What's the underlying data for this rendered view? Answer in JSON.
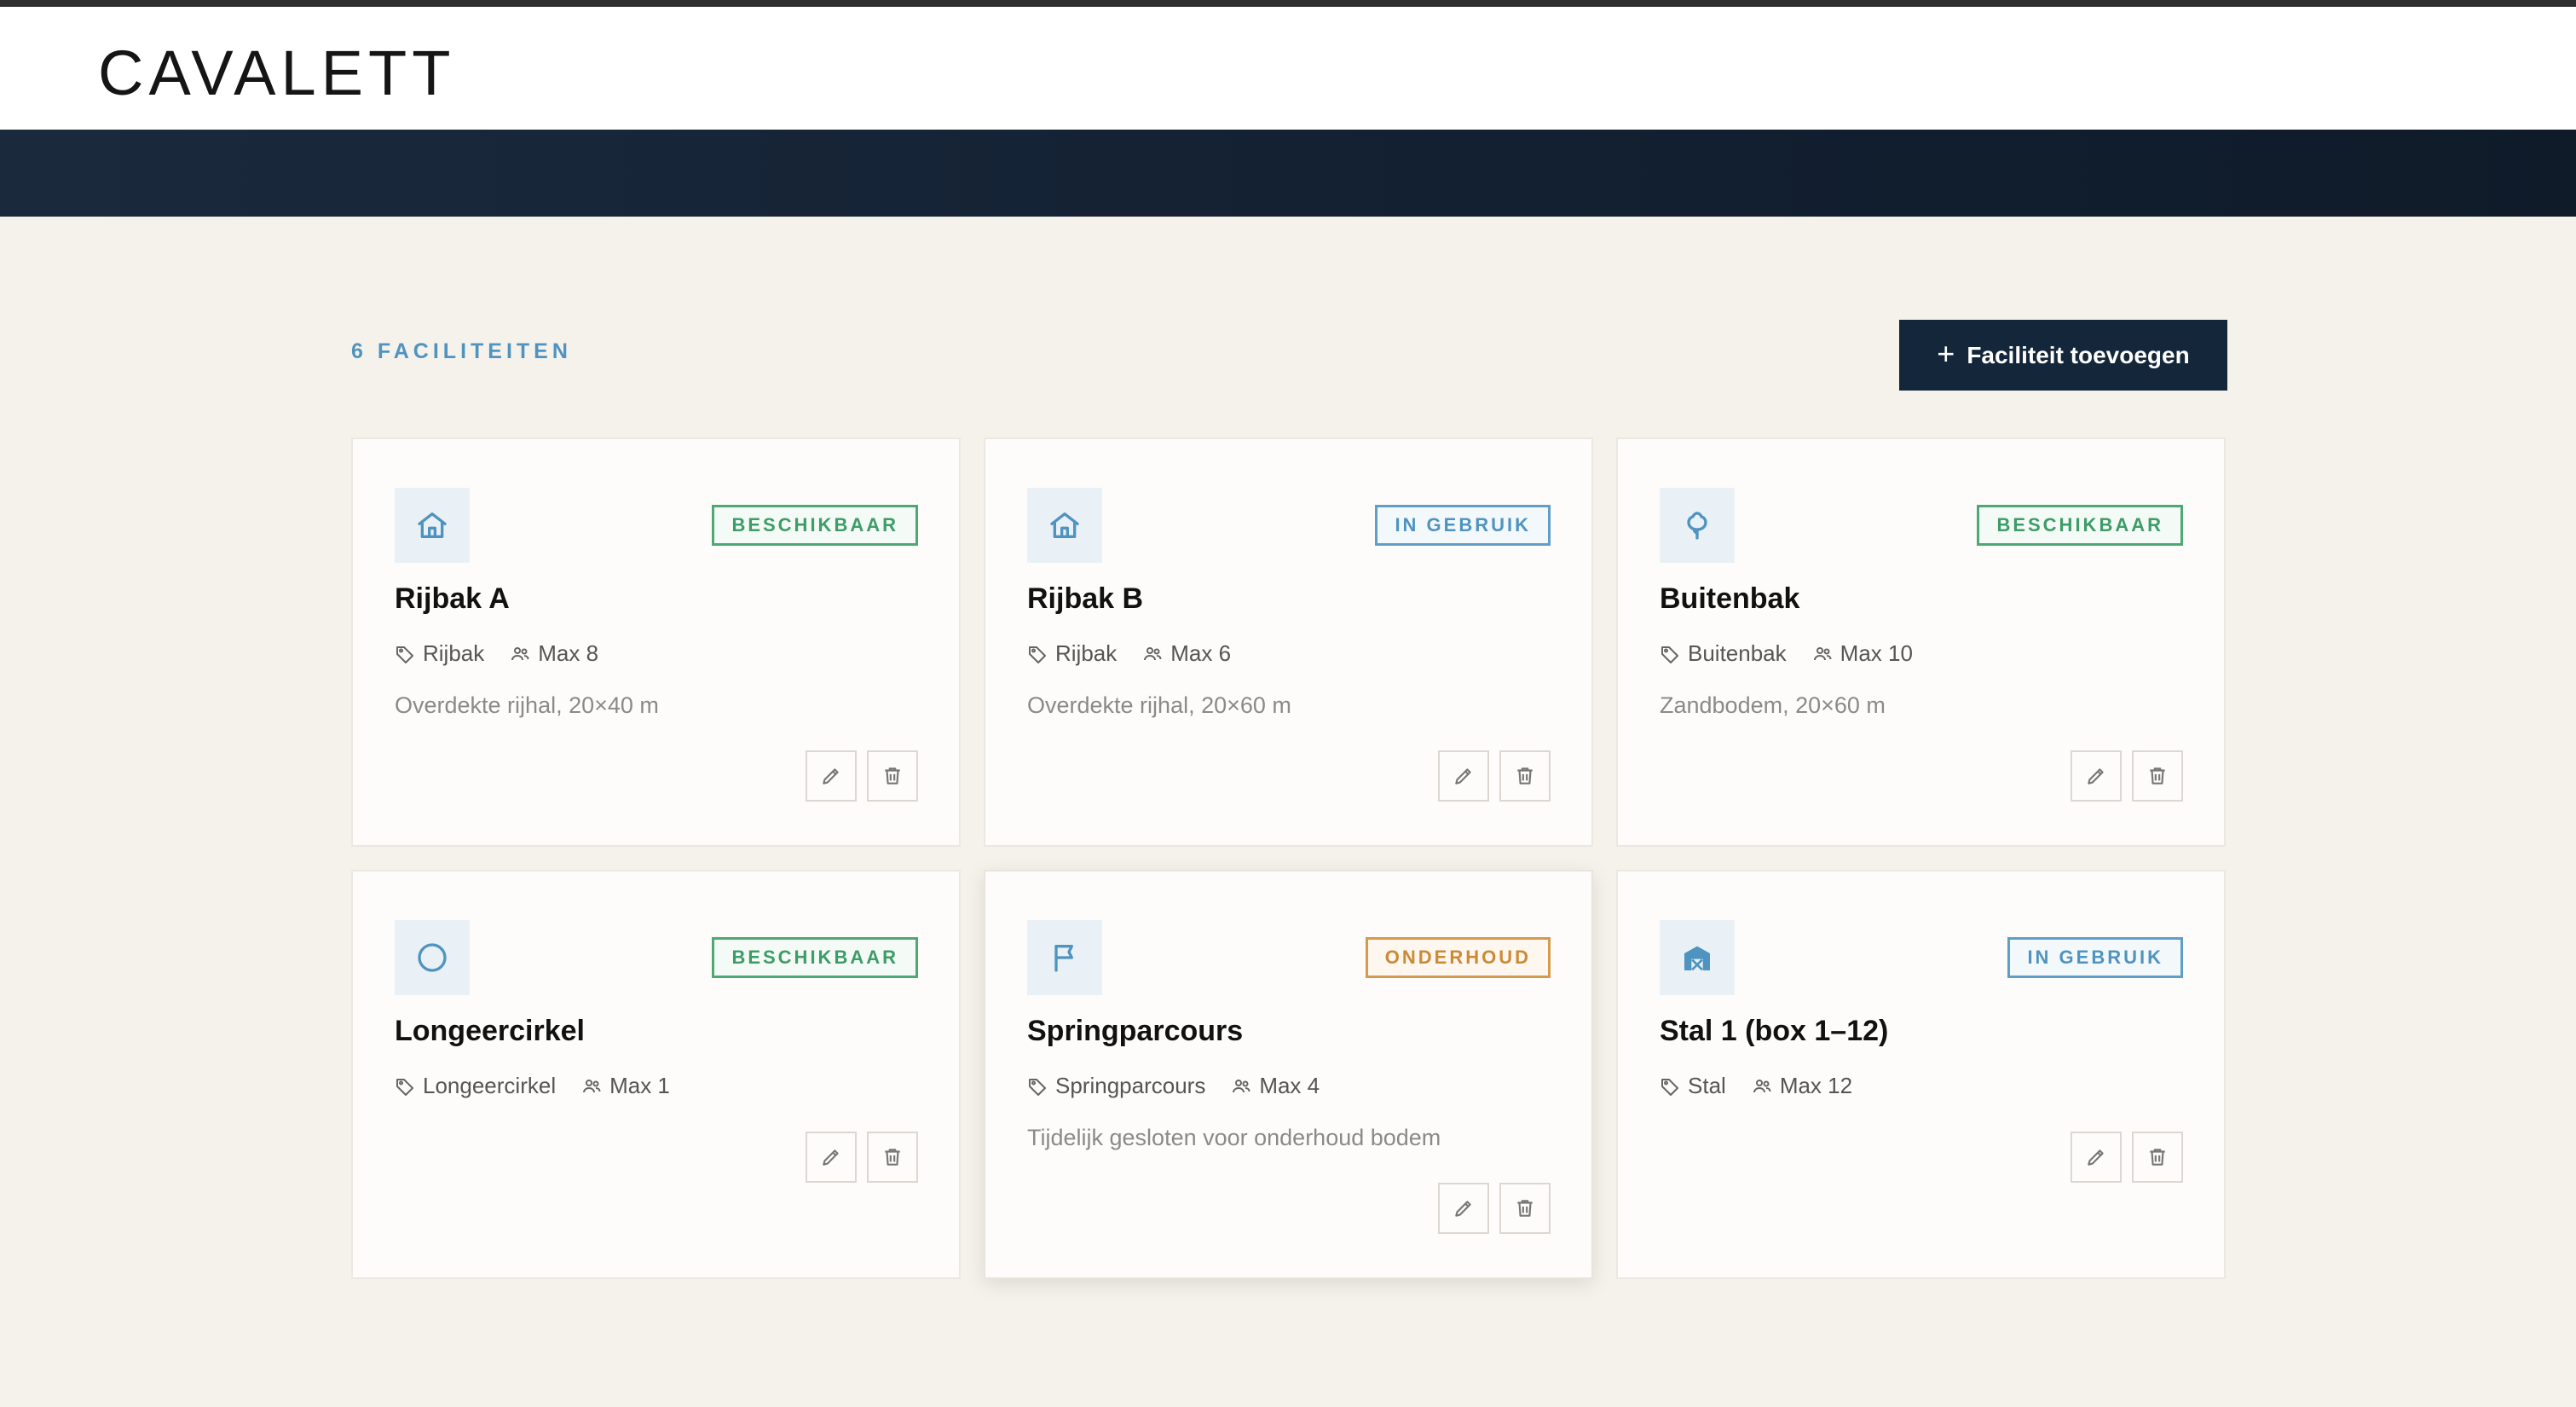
{
  "app": {
    "logo": "CAVALETT"
  },
  "toolbar": {
    "count_label": "6 FACILITEITEN",
    "add_label": "Faciliteit toevoegen",
    "add_icon": "plus-icon"
  },
  "colors": {
    "accent": "#4f94c0",
    "banner": "#132133",
    "available": "#3d9c67",
    "in_use": "#4f94c0",
    "maintenance": "#cc8a35",
    "page_bg": "#f5f2ec"
  },
  "facilities": [
    {
      "title": "Rijbak A",
      "icon": "house-icon",
      "status": "BESCHIKBAAR",
      "status_kind": "available",
      "type": "Rijbak",
      "capacity": "Max 8",
      "description": "Overdekte rijhal, 20×40 m"
    },
    {
      "title": "Rijbak B",
      "icon": "house-icon",
      "status": "IN GEBRUIK",
      "status_kind": "inuse",
      "type": "Rijbak",
      "capacity": "Max 6",
      "description": "Overdekte rijhal, 20×60 m"
    },
    {
      "title": "Buitenbak",
      "icon": "tree-icon",
      "status": "BESCHIKBAAR",
      "status_kind": "available",
      "type": "Buitenbak",
      "capacity": "Max 10",
      "description": "Zandbodem, 20×60 m"
    },
    {
      "title": "Longeercirkel",
      "icon": "circle-icon",
      "status": "BESCHIKBAAR",
      "status_kind": "available",
      "type": "Longeercirkel",
      "capacity": "Max 1",
      "description": ""
    },
    {
      "title": "Springparcours",
      "icon": "flag-icon",
      "status": "ONDERHOUD",
      "status_kind": "maint",
      "type": "Springparcours",
      "capacity": "Max 4",
      "description": "Tijdelijk gesloten voor onderhoud bodem"
    },
    {
      "title": "Stal 1 (box 1–12)",
      "icon": "barn-icon",
      "status": "IN GEBRUIK",
      "status_kind": "inuse",
      "type": "Stal",
      "capacity": "Max 12",
      "description": ""
    }
  ]
}
